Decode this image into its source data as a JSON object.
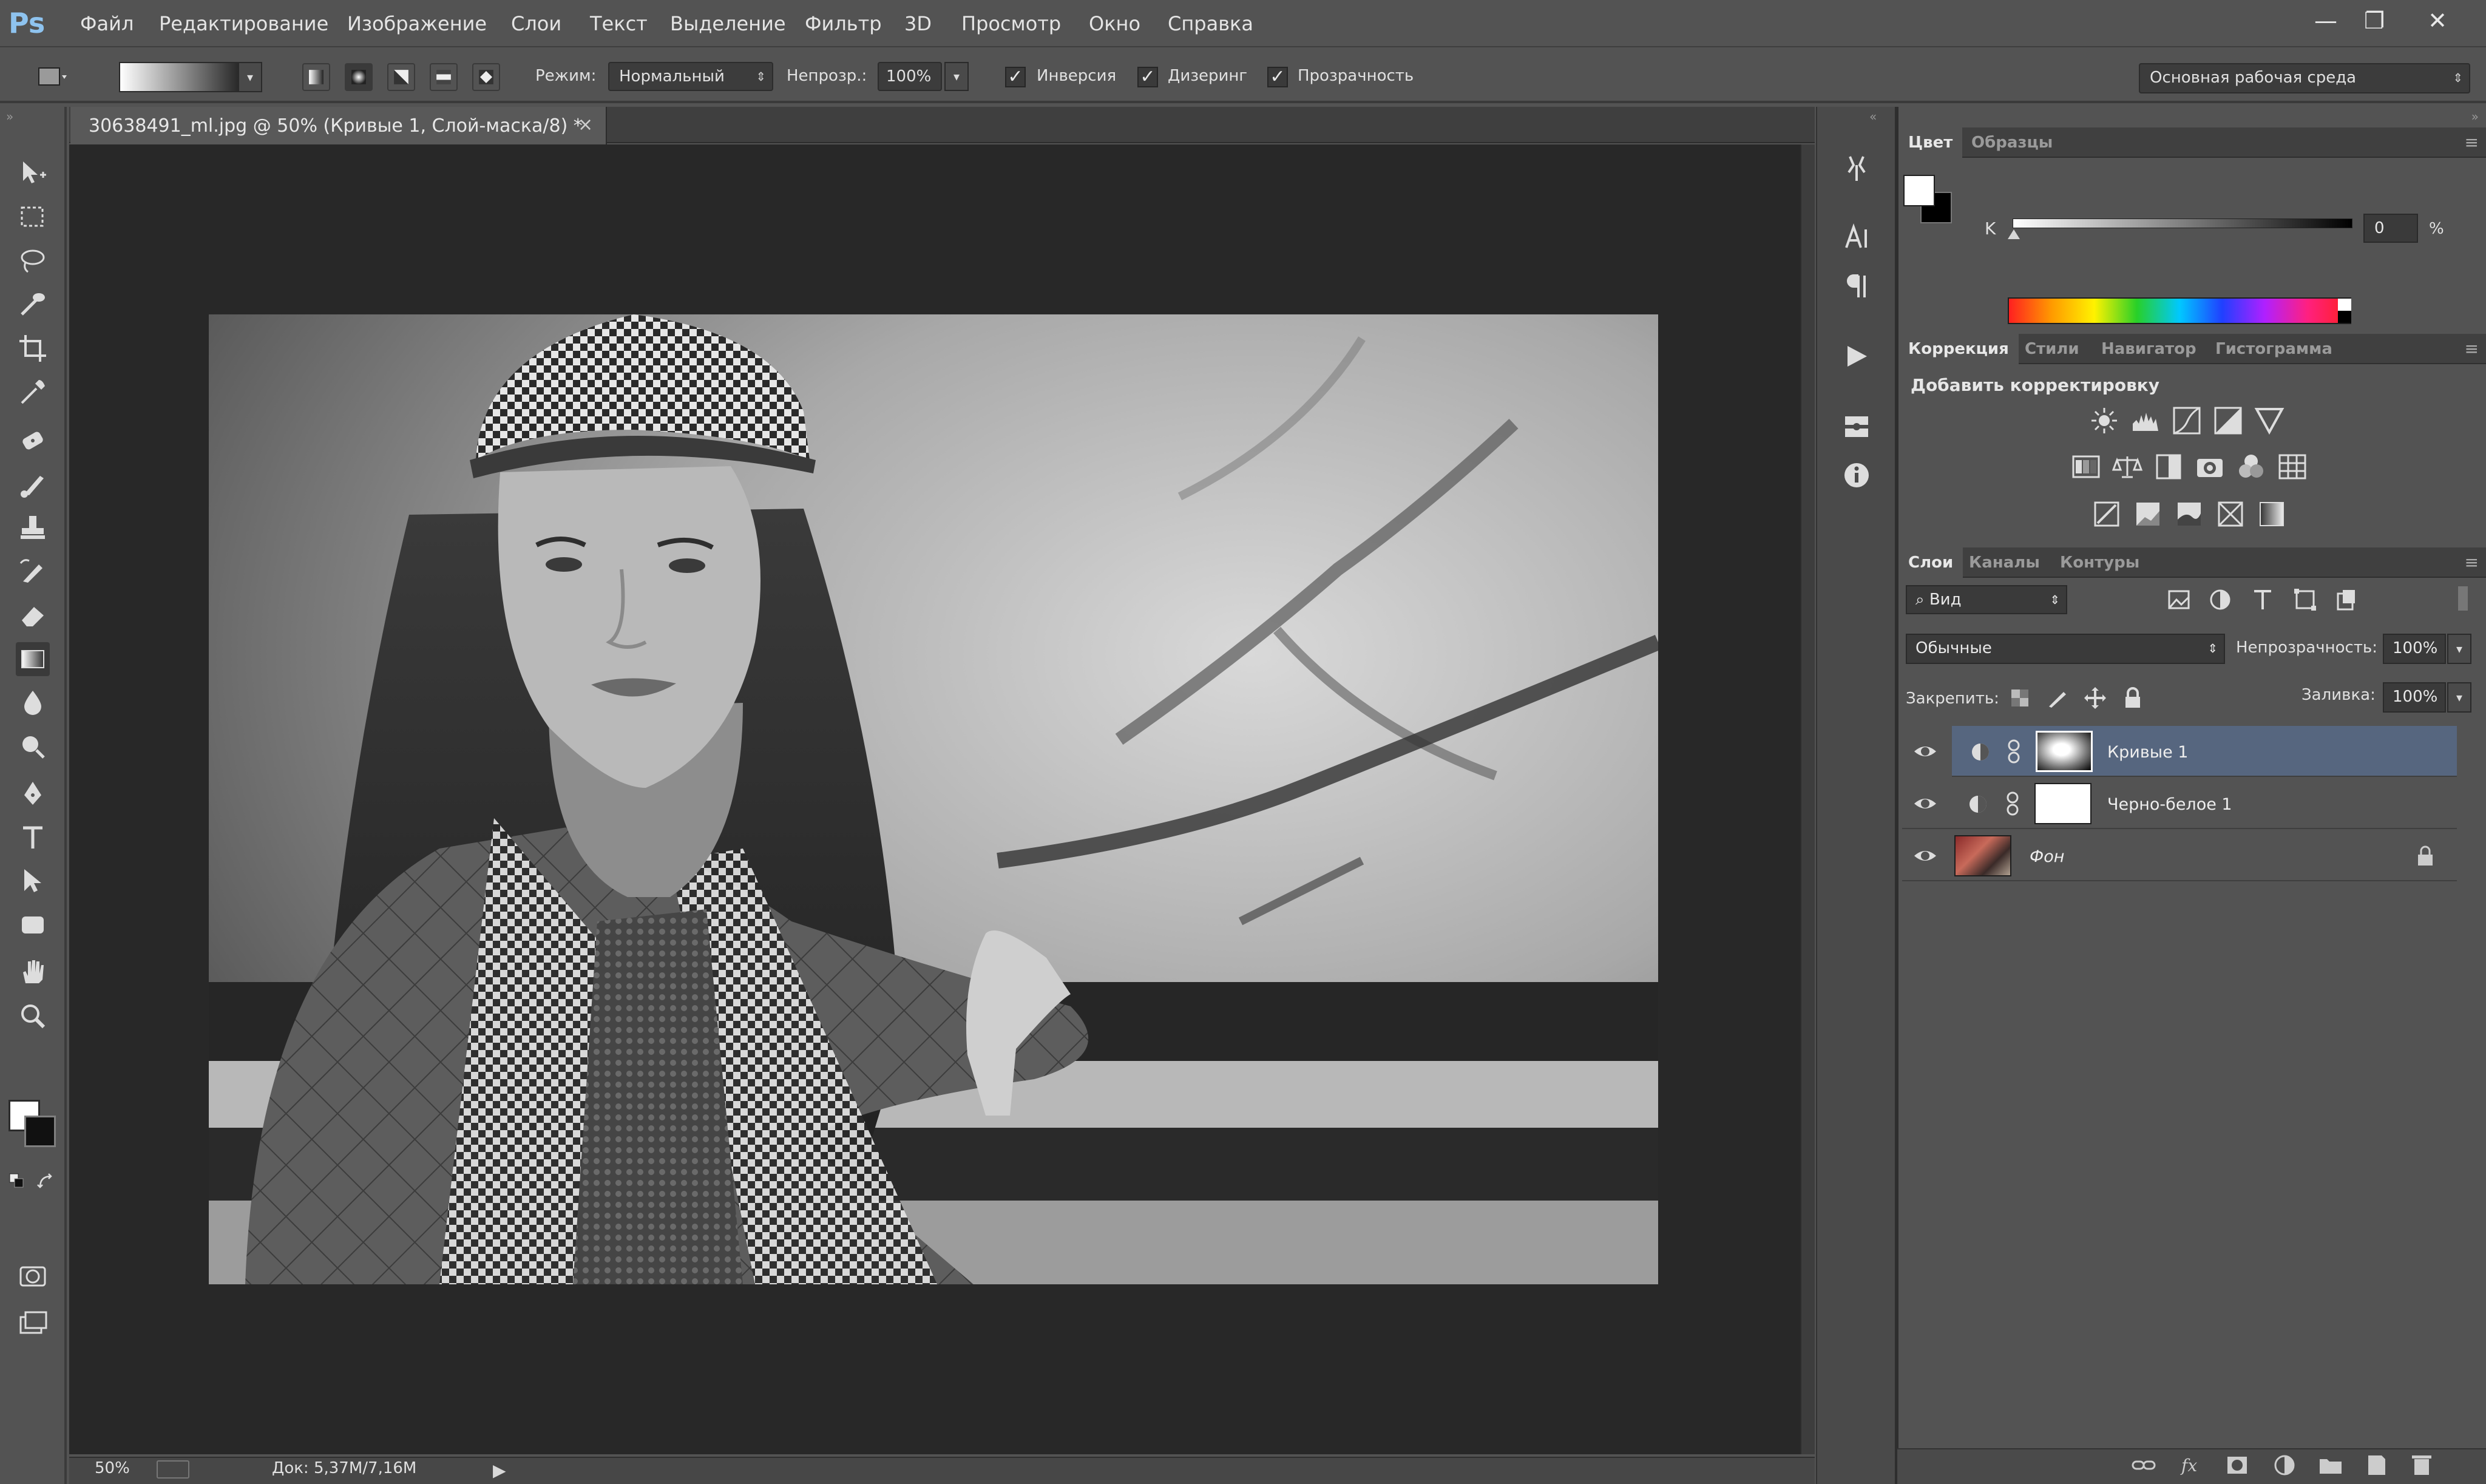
{
  "app": {
    "logo": "Ps"
  },
  "menu": [
    "Файл",
    "Редактирование",
    "Изображение",
    "Слои",
    "Текст",
    "Выделение",
    "Фильтр",
    "3D",
    "Просмотр",
    "Окно",
    "Справка"
  ],
  "window_controls": {
    "minimize": "—",
    "restore": "❐",
    "close": "✕"
  },
  "options": {
    "mode_label": "Режим:",
    "mode_value": "Нормальный",
    "opacity_label": "Непрозр.:",
    "opacity_value": "100%",
    "inversion_label": "Инверсия",
    "inversion_checked": true,
    "dither_label": "Дизеринг",
    "dither_checked": true,
    "transparency_label": "Прозрачность",
    "transparency_checked": true,
    "workspace": "Основная рабочая среда",
    "check_glyph": "✓"
  },
  "document": {
    "tab_title": "30638491_ml.jpg @ 50% (Кривые 1, Слой-маска/8) *",
    "close_glyph": "×",
    "photo_icon": "grayscale-portrait-photo"
  },
  "status": {
    "zoom": "50%",
    "doc_size": "Док: 5,37M/7,16M",
    "arrow_glyph": "▶"
  },
  "color_panel": {
    "tabs": [
      "Цвет",
      "Образцы"
    ],
    "active_tab": 0,
    "channel_label": "K",
    "value": "0",
    "unit": "%",
    "foreground": "#ffffff",
    "background": "#000000"
  },
  "adjustments_panel": {
    "tabs": [
      "Коррекция",
      "Стили",
      "Навигатор",
      "Гистограмма"
    ],
    "active_tab": 0,
    "title": "Добавить корректировку"
  },
  "layers_panel": {
    "tabs": [
      "Слои",
      "Каналы",
      "Контуры"
    ],
    "active_tab": 0,
    "filter_placeholder": "Вид",
    "blend_mode": "Обычные",
    "opacity_label": "Непрозрачность:",
    "opacity_value": "100%",
    "lock_label": "Закрепить:",
    "fill_label": "Заливка:",
    "fill_value": "100%",
    "layers": [
      {
        "name": "Кривые 1",
        "selected": true,
        "thumb": "curves-mask-thumbnail"
      },
      {
        "name": "Черно-белое 1",
        "selected": false,
        "thumb": "white-mask-thumbnail"
      },
      {
        "name": "Фон",
        "selected": false,
        "thumb": "photo-thumbnail",
        "locked": true
      }
    ]
  },
  "panel_menu_glyph": "≡",
  "colors": {
    "ui_gray": "#535353",
    "canvas_bg": "#282828",
    "selected_layer": "#56667f",
    "ps_blue": "#8ec3ef"
  }
}
